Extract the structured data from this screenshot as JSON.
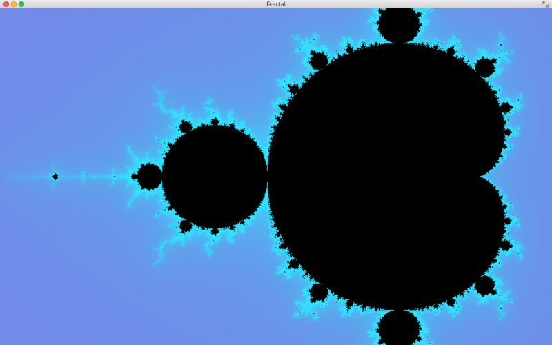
{
  "window": {
    "title": "Fractal"
  },
  "controls": {
    "close_icon": "close-icon",
    "minimize_icon": "minimize-icon",
    "zoom_icon": "zoom-icon",
    "fullscreen_icon": "fullscreen-icon"
  },
  "canvas": {
    "view": {
      "re_min": -2.02,
      "re_max": 0.6,
      "im_min": -0.82,
      "im_max": 0.82
    },
    "max_iterations": 120,
    "colors": {
      "set": "#000000",
      "glow": "#33e0ff",
      "mid": "#5aa8ee",
      "outer": "#7b7fe6"
    }
  }
}
